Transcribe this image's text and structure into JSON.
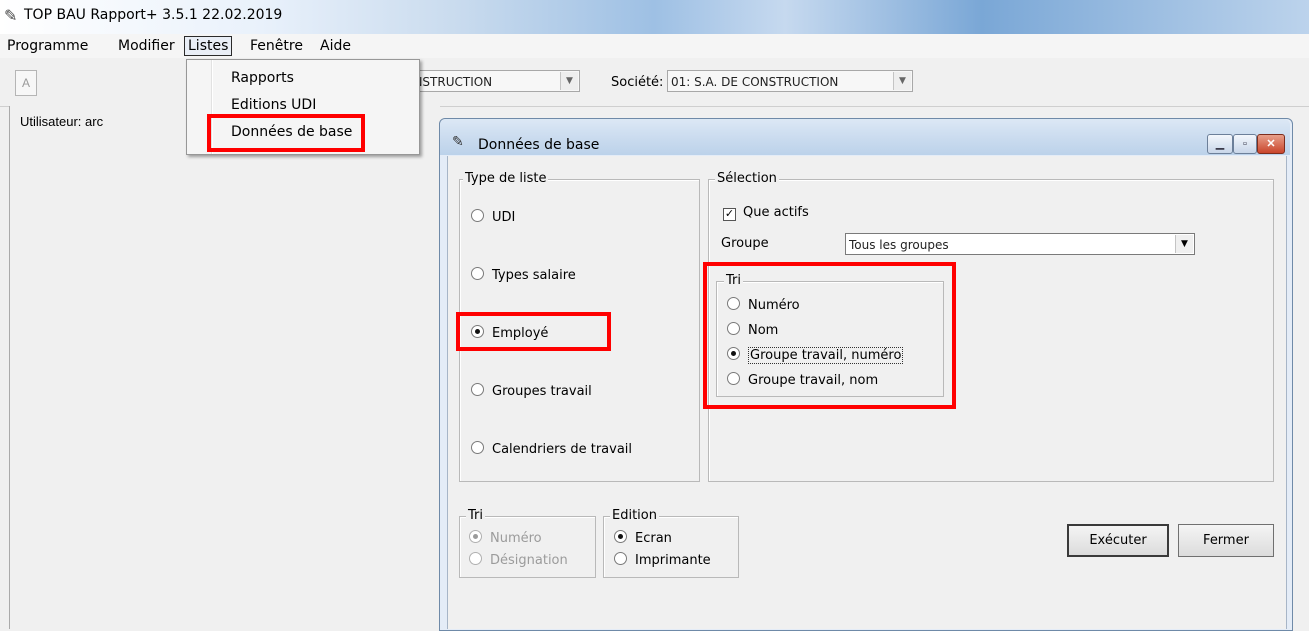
{
  "window": {
    "title": "TOP BAU Rapport+ 3.5.1  22.02.2019"
  },
  "menubar": {
    "items": [
      "Programme",
      "Modifier",
      "Listes",
      "Fenêtre",
      "Aide"
    ]
  },
  "toolbar": {
    "a_button": "A",
    "combo1_value": "ONSTRUCTION",
    "societe_label": "Société:",
    "societe_value": "01: S.A. DE CONSTRUCTION"
  },
  "left_panel": {
    "user_label": "Utilisateur:  arc"
  },
  "dropdown": {
    "items": [
      "Rapports",
      "Editions UDI",
      "Données de base"
    ],
    "highlighted": "Données de base"
  },
  "dialog": {
    "title": "Données de base",
    "type_liste": {
      "title": "Type de liste",
      "options": [
        "UDI",
        "Types salaire",
        "Employé",
        "Groupes travail",
        "Calendriers de travail"
      ],
      "selected": "Employé"
    },
    "selection": {
      "title": "Sélection",
      "que_actifs_label": "Que actifs",
      "que_actifs_checked": true,
      "groupe_label": "Groupe",
      "groupe_value": "Tous les groupes",
      "tri": {
        "title": "Tri",
        "options": [
          "Numéro",
          "Nom",
          "Groupe travail, numéro",
          "Groupe travail, nom"
        ],
        "selected": "Groupe travail, numéro"
      }
    },
    "tri_bottom": {
      "title": "Tri",
      "options": [
        "Numéro",
        "Désignation"
      ],
      "selected": "Numéro",
      "disabled": true
    },
    "edition": {
      "title": "Edition",
      "options": [
        "Ecran",
        "Imprimante"
      ],
      "selected": "Ecran"
    },
    "buttons": {
      "executer": "Exécuter",
      "fermer": "Fermer"
    }
  },
  "colors": {
    "highlight": "#ff0000",
    "dialog_frame": "#c8daee"
  }
}
